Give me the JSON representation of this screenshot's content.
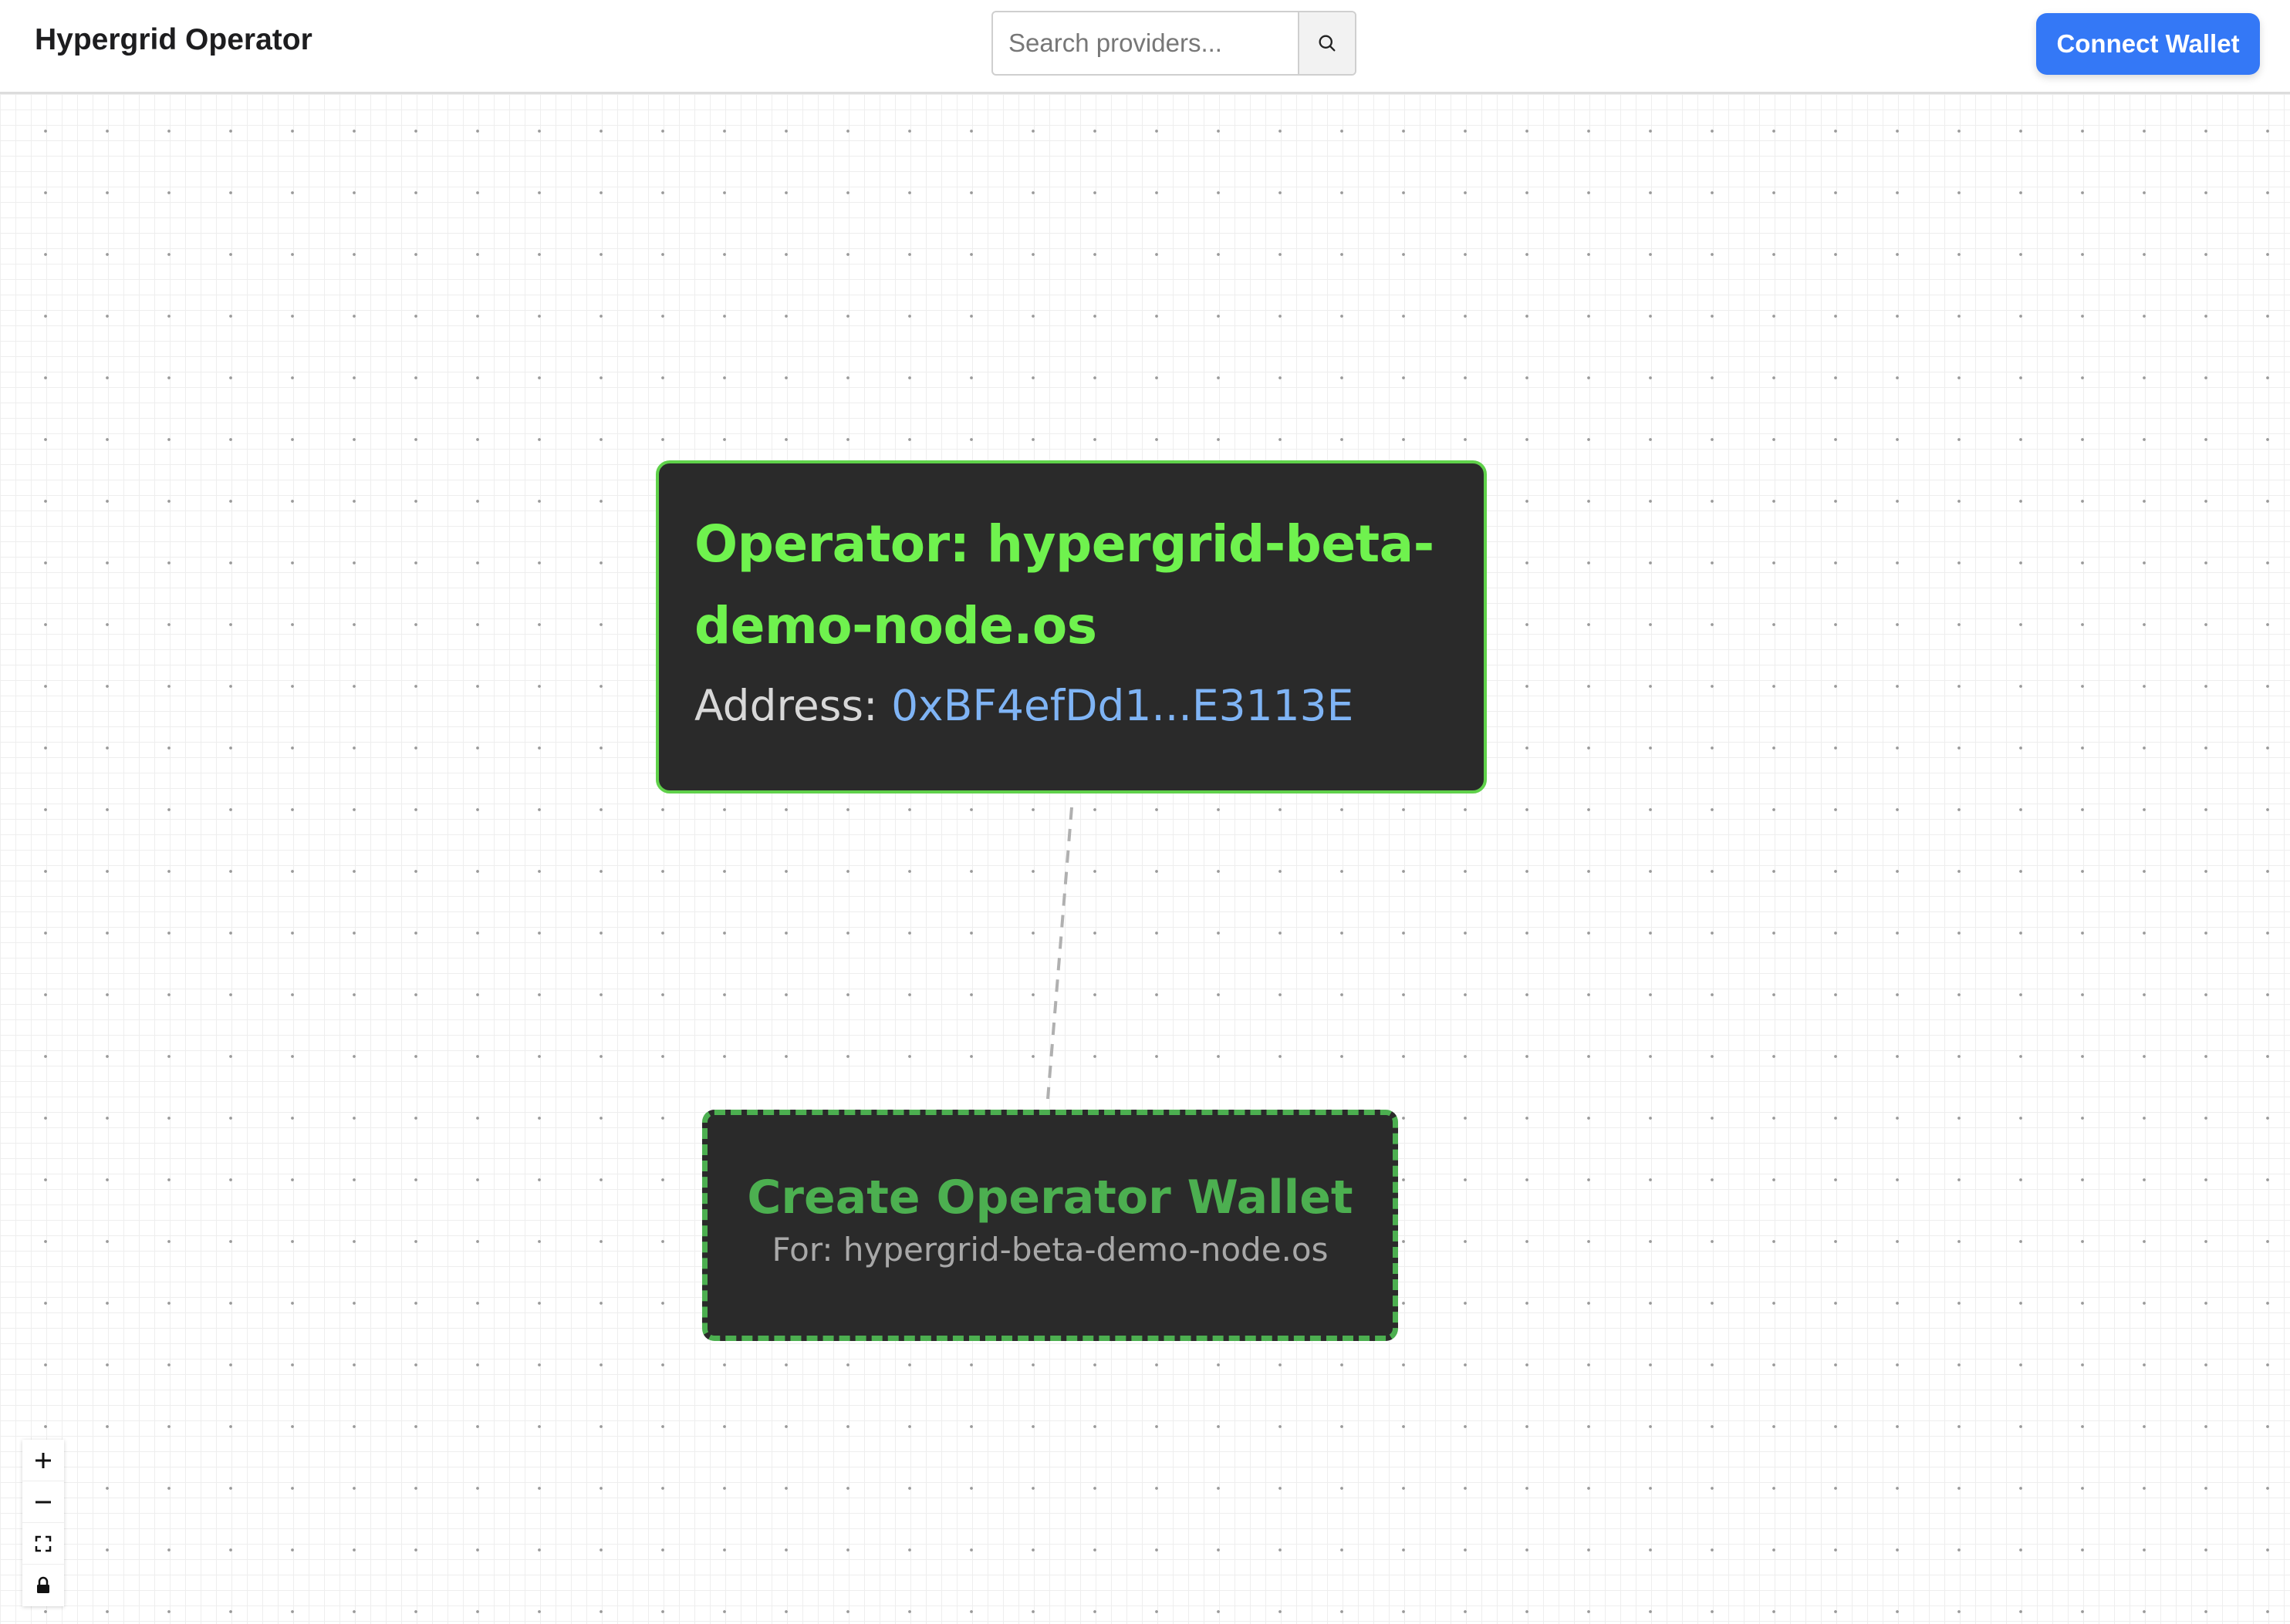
{
  "header": {
    "title": "Hypergrid Operator",
    "search": {
      "placeholder": "Search providers...",
      "value": "",
      "button_icon": "search-icon"
    },
    "connect_button_label": "Connect Wallet",
    "accent_color": "#3478f6"
  },
  "graph": {
    "operator_node": {
      "title": "Operator: hypergrid-beta-demo-node.os",
      "address_label": "Address:",
      "address_value": "0xBF4efDd1...E3113E",
      "border_color": "#5fd14a",
      "title_color": "#6ff24e"
    },
    "create_wallet_node": {
      "title": "Create Operator Wallet",
      "subtitle": "For: hypergrid-beta-demo-node.os",
      "border_style": "dashed",
      "color": "#4caf50"
    },
    "edge": {
      "from": "operator_node",
      "to": "create_wallet_node",
      "style": "dashed"
    }
  },
  "controls": [
    {
      "name": "zoom-in",
      "icon": "plus-icon"
    },
    {
      "name": "zoom-out",
      "icon": "minus-icon"
    },
    {
      "name": "fit-view",
      "icon": "fit-view-icon"
    },
    {
      "name": "toggle-interactivity",
      "icon": "lock-icon"
    }
  ]
}
